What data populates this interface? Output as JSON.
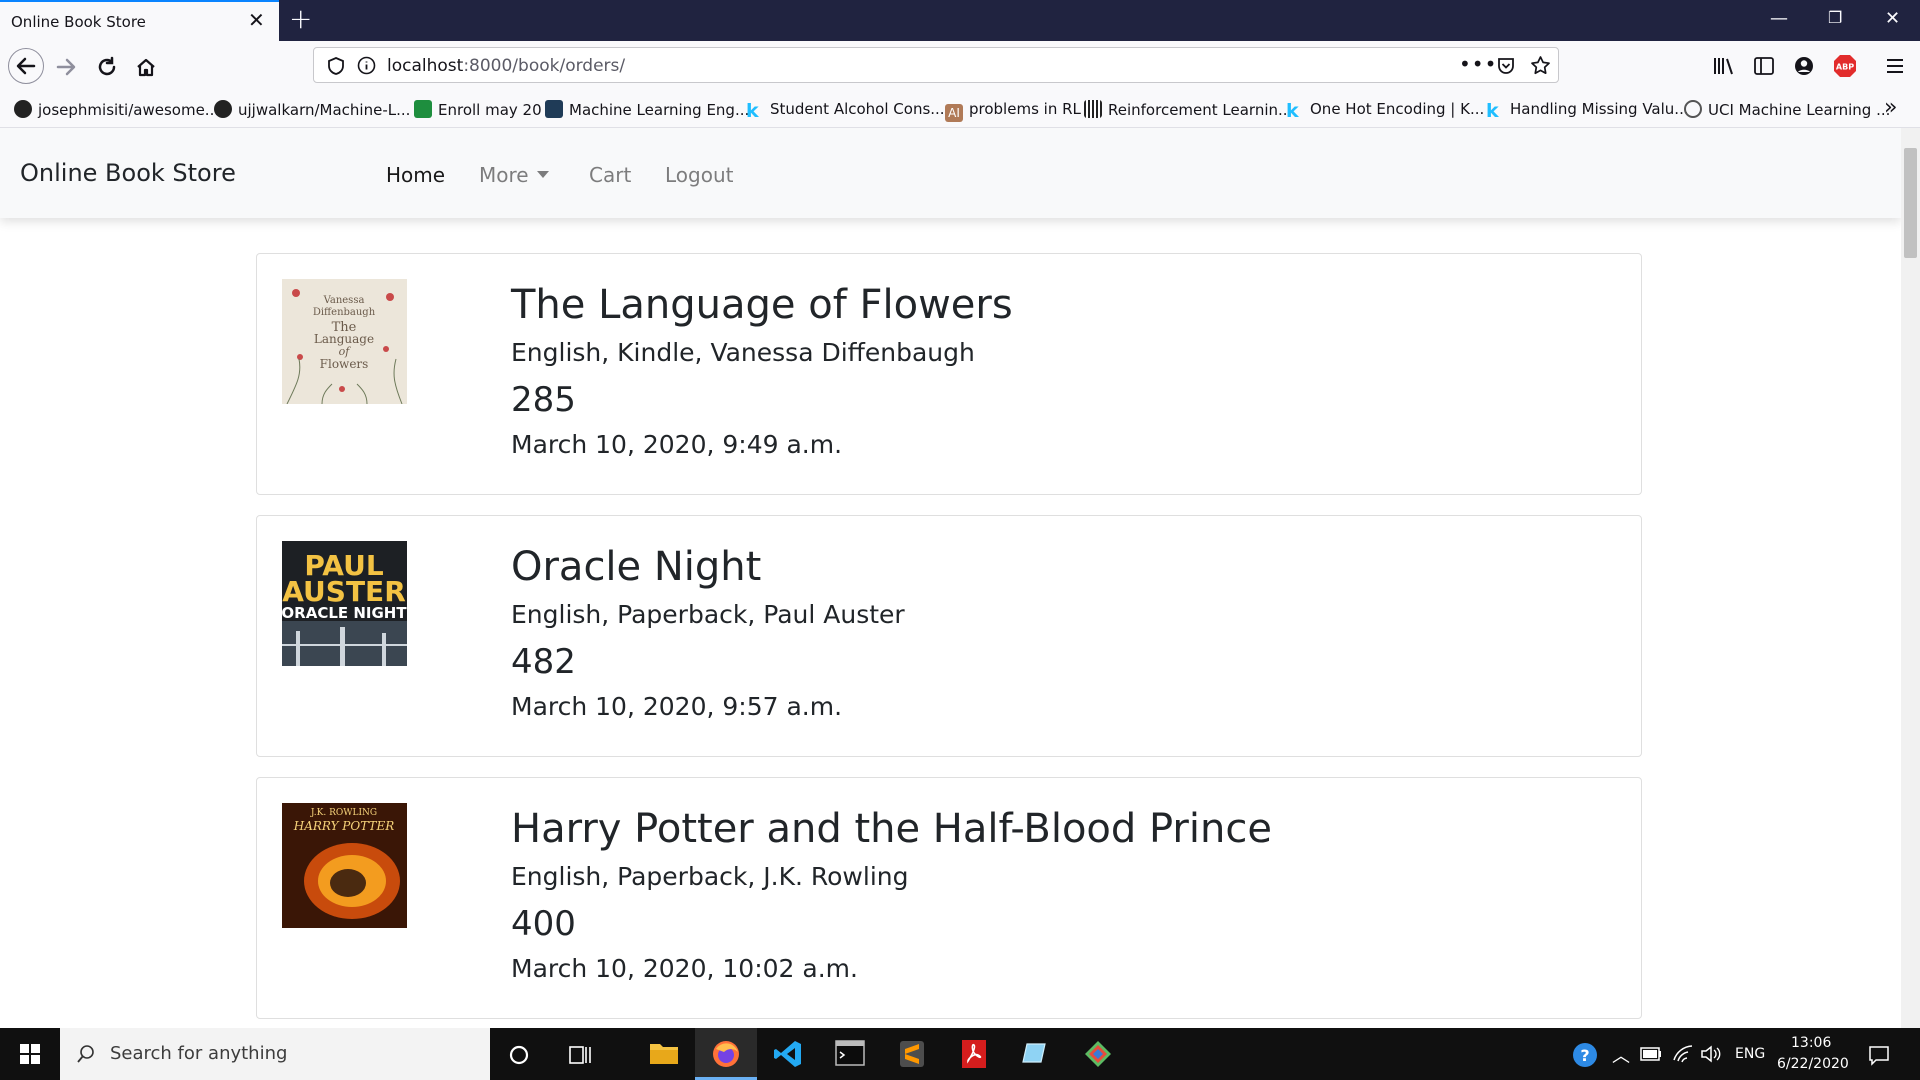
{
  "browser": {
    "tab_title": "Online Book Store",
    "url_host": "localhost",
    "url_rest": ":8000/book/orders/",
    "bookmarks": [
      {
        "label": "josephmisiti/awesome...",
        "icon_color": "#222222"
      },
      {
        "label": "ujjwalkarn/Machine-L...",
        "icon_color": "#222222"
      },
      {
        "label": "Enroll may 20",
        "icon_color": "#1e8e3e"
      },
      {
        "label": "Machine Learning Eng...",
        "icon_color": "#1f3b57"
      },
      {
        "label": "Student Alcohol Cons...",
        "icon_color": "#20beff"
      },
      {
        "label": "problems in RL",
        "icon_color": "#b07a57"
      },
      {
        "label": "Reinforcement Learnin...",
        "icon_color": "#222222"
      },
      {
        "label": "One Hot Encoding | K...",
        "icon_color": "#20beff"
      },
      {
        "label": "Handling Missing Valu...",
        "icon_color": "#20beff"
      },
      {
        "label": "UCI Machine Learning ...",
        "icon_color": "#555555"
      }
    ]
  },
  "site": {
    "brand": "Online Book Store",
    "nav": {
      "home": "Home",
      "more": "More",
      "cart": "Cart",
      "logout": "Logout"
    }
  },
  "orders": [
    {
      "title": "The Language of Flowers",
      "meta": "English, Kindle, Vanessa Diffenbaugh",
      "price": "285",
      "date": "March 10, 2020, 9:49 a.m.",
      "cover": {
        "bg": "#ece6da",
        "fg": "#6b5b4b",
        "lines": [
          "Vanessa",
          "Diffenbaugh",
          "The",
          "Language",
          "of",
          "Flowers"
        ]
      }
    },
    {
      "title": "Oracle Night",
      "meta": "English, Paperback, Paul Auster",
      "price": "482",
      "date": "March 10, 2020, 9:57 a.m.",
      "cover": {
        "bg": "#1d2024",
        "fg": "#f3c243",
        "lines": [
          "PAUL",
          "AUSTER",
          "ORACLE NIGHT"
        ]
      }
    },
    {
      "title": "Harry Potter and the Half-Blood Prince",
      "meta": "English, Paperback, J.K. Rowling",
      "price": "400",
      "date": "March 10, 2020, 10:02 a.m.",
      "cover": {
        "bg": "#3a1606",
        "fg": "#f6d37a",
        "lines": [
          "J.K. ROWLING",
          "HARRY POTTER"
        ]
      }
    }
  ],
  "taskbar": {
    "search_placeholder": "Search for anything",
    "lang": "ENG",
    "time": "13:06",
    "date": "6/22/2020"
  }
}
